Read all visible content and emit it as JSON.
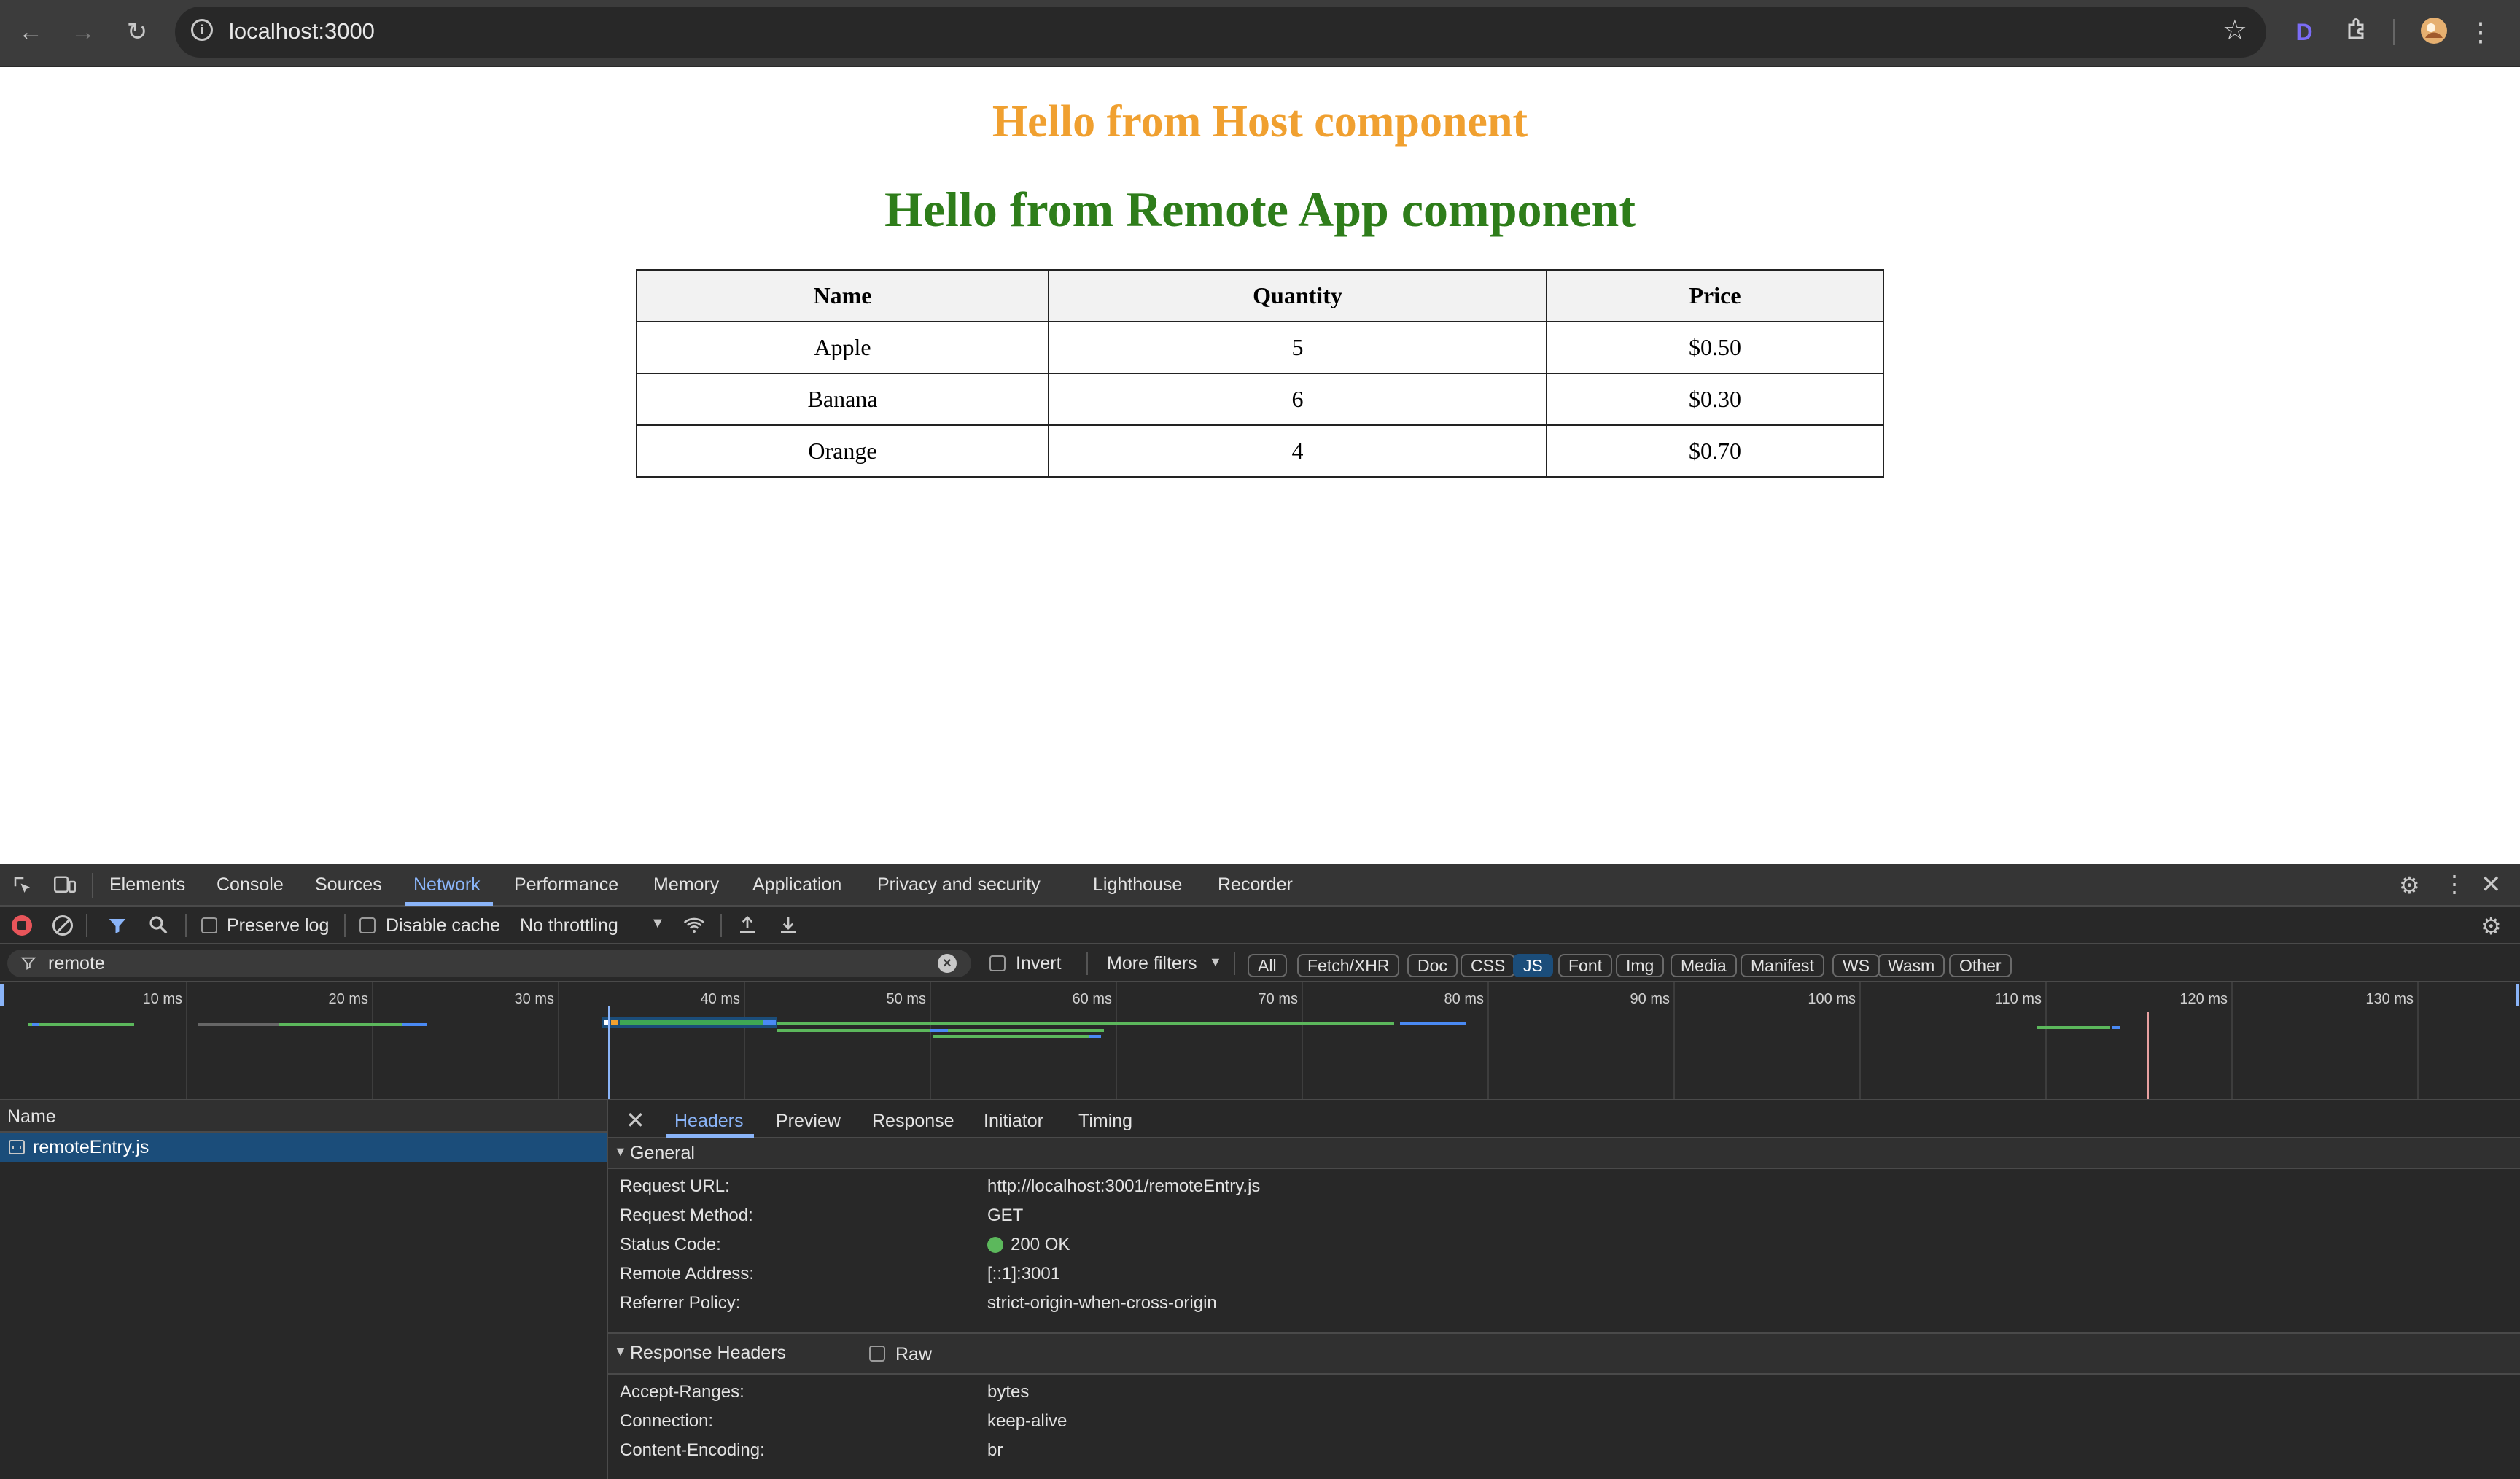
{
  "browser": {
    "url": "localhost:3000",
    "ext_letter": "D"
  },
  "page": {
    "host_title": "Hello from Host component",
    "remote_title": "Hello from Remote App component",
    "table": {
      "headers": [
        "Name",
        "Quantity",
        "Price"
      ],
      "rows": [
        [
          "Apple",
          "5",
          "$0.50"
        ],
        [
          "Banana",
          "6",
          "$0.30"
        ],
        [
          "Orange",
          "4",
          "$0.70"
        ]
      ]
    }
  },
  "devtools": {
    "tabs": [
      "Elements",
      "Console",
      "Sources",
      "Network",
      "Performance",
      "Memory",
      "Application",
      "Privacy and security",
      "Lighthouse",
      "Recorder"
    ],
    "active_tab": "Network",
    "toolbar": {
      "preserve_log": "Preserve log",
      "disable_cache": "Disable cache",
      "throttling": "No throttling"
    },
    "filter": {
      "value": "remote",
      "invert": "Invert",
      "more_filters": "More filters",
      "types": [
        "All",
        "Fetch/XHR",
        "Doc",
        "CSS",
        "JS",
        "Font",
        "Img",
        "Media",
        "Manifest",
        "WS",
        "Wasm",
        "Other"
      ],
      "active_type": "JS"
    },
    "timeline_ticks": [
      "10 ms",
      "20 ms",
      "30 ms",
      "40 ms",
      "50 ms",
      "60 ms",
      "70 ms",
      "80 ms",
      "90 ms",
      "100 ms",
      "110 ms",
      "120 ms",
      "130 ms"
    ],
    "requests_header": "Name",
    "requests": [
      "remoteEntry.js"
    ],
    "detail_tabs": [
      "Headers",
      "Preview",
      "Response",
      "Initiator",
      "Timing"
    ],
    "active_detail_tab": "Headers",
    "general": {
      "title": "General",
      "fields": [
        {
          "key": "Request URL:",
          "value": "http://localhost:3001/remoteEntry.js"
        },
        {
          "key": "Request Method:",
          "value": "GET"
        },
        {
          "key": "Status Code:",
          "value": "200 OK"
        },
        {
          "key": "Remote Address:",
          "value": "[::1]:3001"
        },
        {
          "key": "Referrer Policy:",
          "value": "strict-origin-when-cross-origin"
        }
      ]
    },
    "response_headers": {
      "title": "Response Headers",
      "raw": "Raw",
      "fields": [
        {
          "key": "Accept-Ranges:",
          "value": "bytes"
        },
        {
          "key": "Connection:",
          "value": "keep-alive"
        },
        {
          "key": "Content-Encoding:",
          "value": "br"
        }
      ]
    },
    "colors": {
      "accent": "#8ab4f8",
      "selected_row": "#1b4d7a",
      "status_ok": "#5cb85c"
    }
  }
}
